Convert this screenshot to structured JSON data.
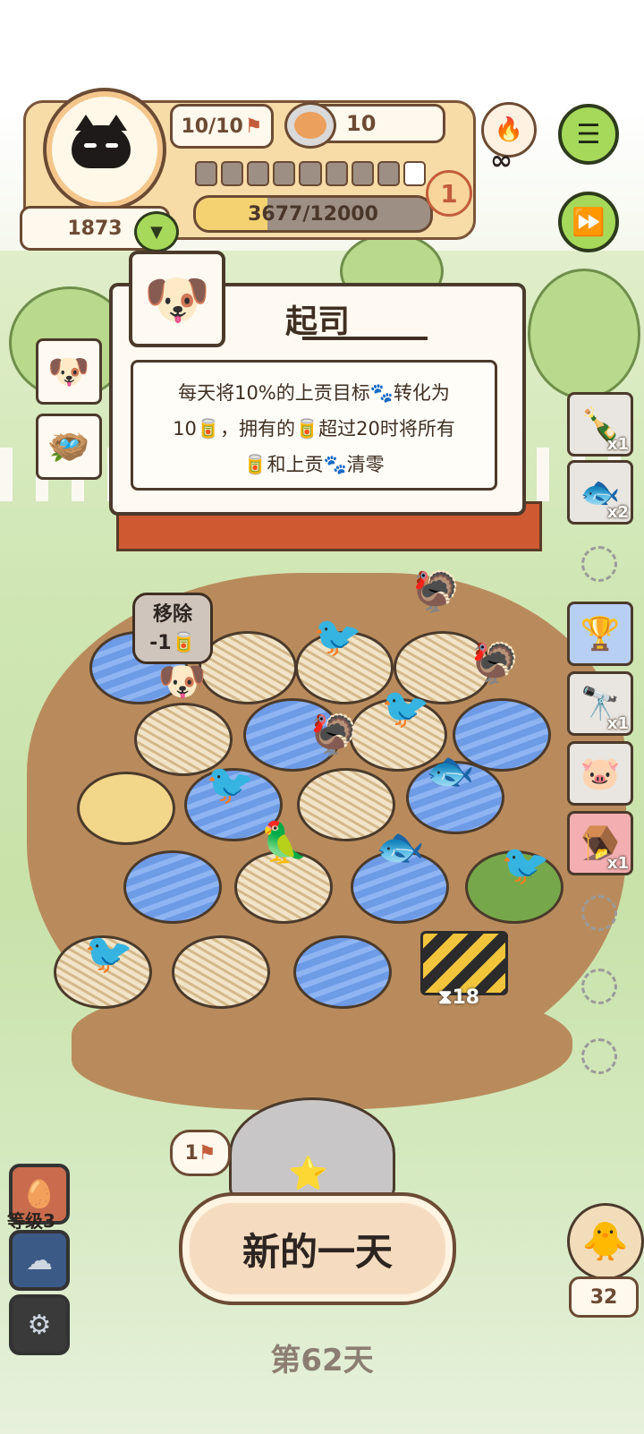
{
  "hud": {
    "energy": "10/10",
    "coins": "10",
    "avatar_number": "1873",
    "level_badge": "1",
    "xp_text": "3677/12000",
    "xp_fraction": 0.306,
    "progress_dots_filled": 8,
    "progress_dots_total": 9,
    "infinity_symbol": "∞"
  },
  "tooltip": {
    "title": "起司",
    "line1": "每天将10%的上贡目标🐾转化为",
    "line2": "10🥫，拥有的🥫超过20时将所有",
    "line3": "🥫和上贡🐾清零"
  },
  "board": {
    "remove_label": "移除",
    "remove_cost": "-1🥫",
    "construction_timer": "⧗18"
  },
  "items": [
    {
      "icon": "bottle-icon",
      "count": "x1"
    },
    {
      "icon": "fish-icon",
      "count": "x2"
    },
    {
      "icon": "trophy-icon",
      "count": ""
    },
    {
      "icon": "binoculars-icon",
      "count": "x1"
    },
    {
      "icon": "piggy-bank-icon",
      "count": ""
    },
    {
      "icon": "birdcage-icon",
      "count": "x1"
    }
  ],
  "bottom": {
    "flag_count": "1",
    "new_day_button": "新的一天",
    "level_label": "等级3",
    "bird_count": "32",
    "day_label": "第62天"
  },
  "colors": {
    "accent_green": "#a6d95a",
    "hud_panel": "#f7dca8",
    "dirt": "#b98b5c",
    "water": "#6e9be6"
  }
}
